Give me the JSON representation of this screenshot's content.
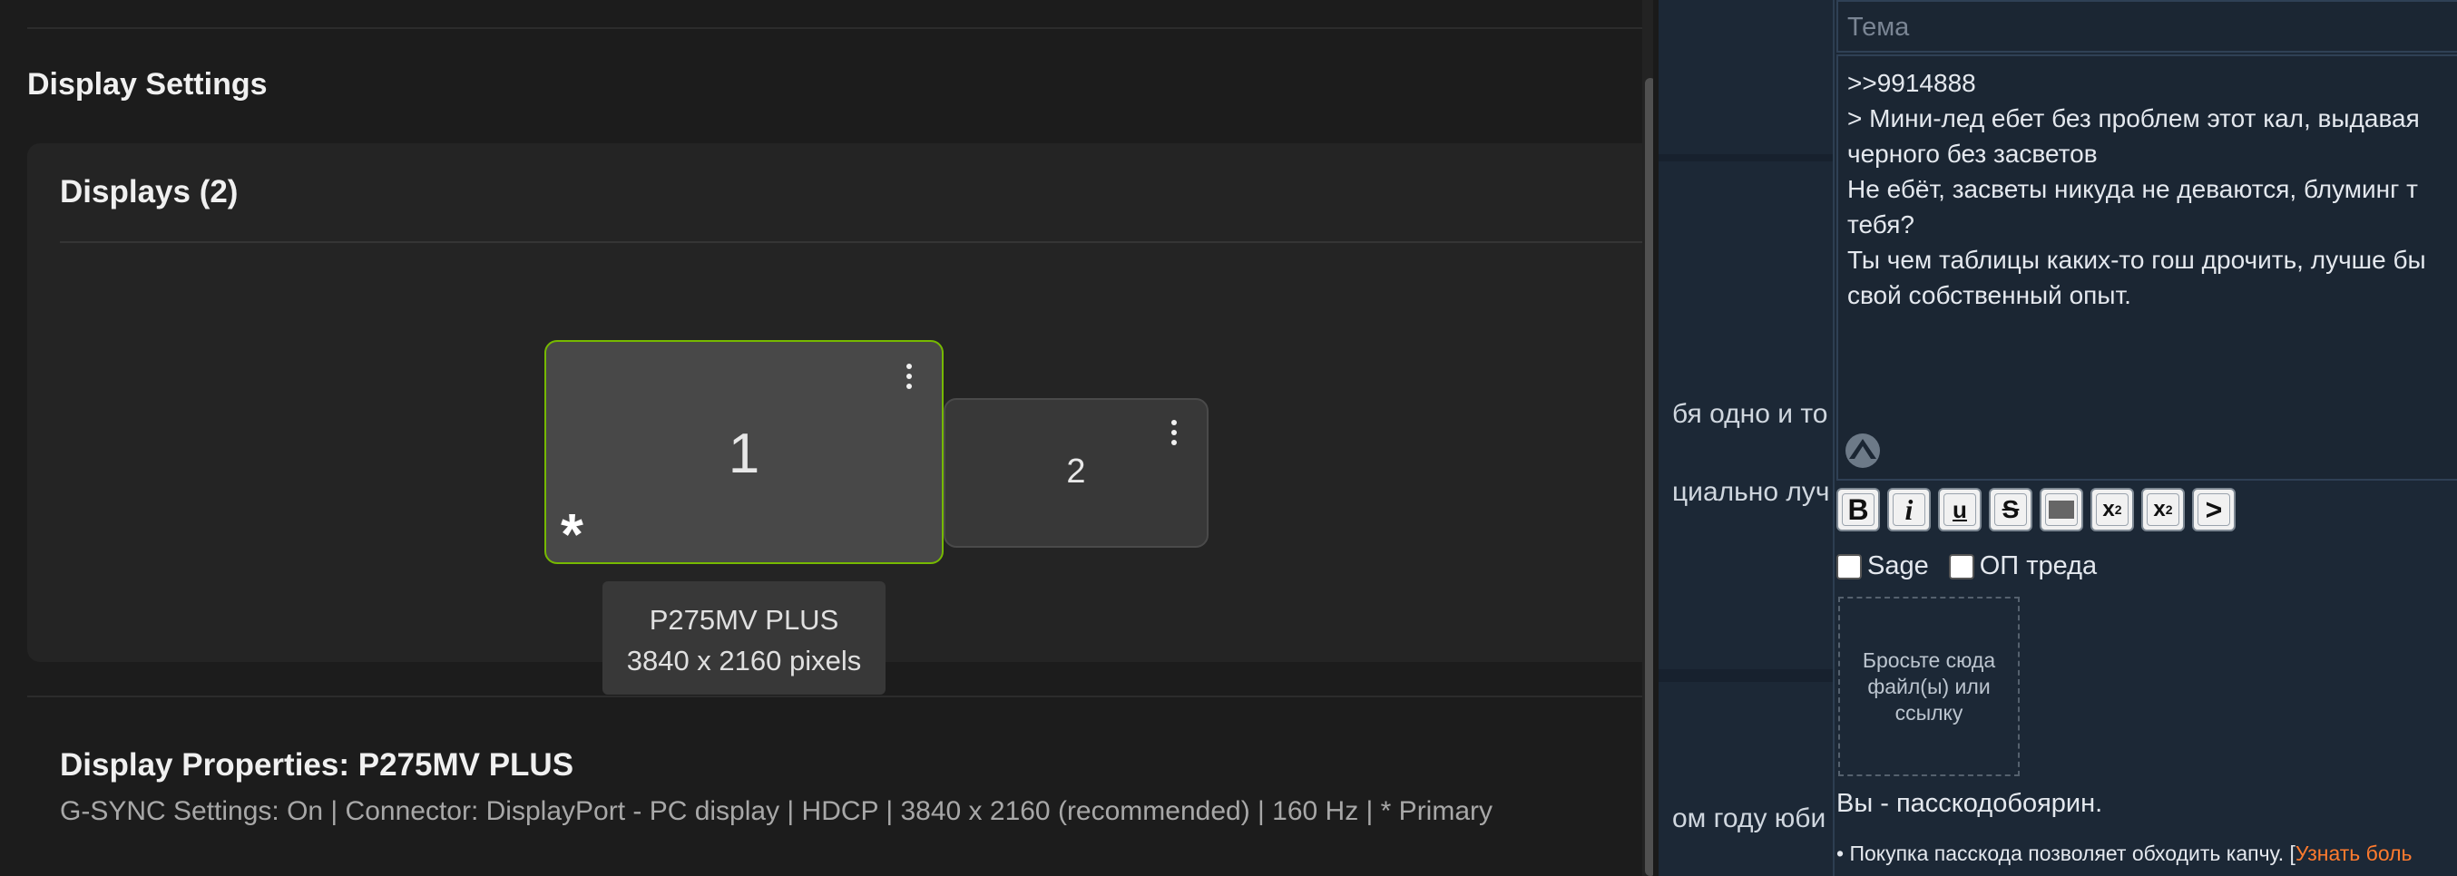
{
  "nvidia": {
    "heading": "Display Settings",
    "displays_title": "Displays (2)",
    "monitors": [
      {
        "number": "1",
        "primary_mark": "*",
        "selected": true
      },
      {
        "number": "2",
        "selected": false
      }
    ],
    "tooltip": {
      "name": "P275MV PLUS",
      "resolution": "3840 x 2160 pixels"
    },
    "properties_title": "Display Properties: P275MV PLUS",
    "properties_text": "G-SYNC Settings: On | Connector: DisplayPort - PC display | HDCP | 3840 x 2160 (recommended) | 160 Hz | * Primary",
    "accent_color": "#76b900"
  },
  "imageboard": {
    "background_lines": [
      "бя одно и то",
      "циально луч",
      "ом году юби"
    ],
    "subject_placeholder": "Тема",
    "message": ">>9914888\n> Мини-лед ебет без проблем этот кал, выдавая\nчерного без засветов\nНе ебёт, засветы никуда не деваются, блуминг т\nтебя?\nТы чем таблицы каких-то гош дрочить, лучше бы\nсвой собственный опыт.",
    "toolbar": [
      "B",
      "i",
      "u",
      "S",
      "spoiler",
      "x²",
      "x₂",
      ">"
    ],
    "checkboxes": [
      "Sage",
      "ОП треда"
    ],
    "dropzone": "Бросьте сюда файл(ы) или ссылку",
    "passcode_title": "Вы - пасскодобоярин.",
    "passcode_info": "• Покупка пасскода позволяет обходить капчу. [",
    "passcode_link": "Узнать боль"
  }
}
